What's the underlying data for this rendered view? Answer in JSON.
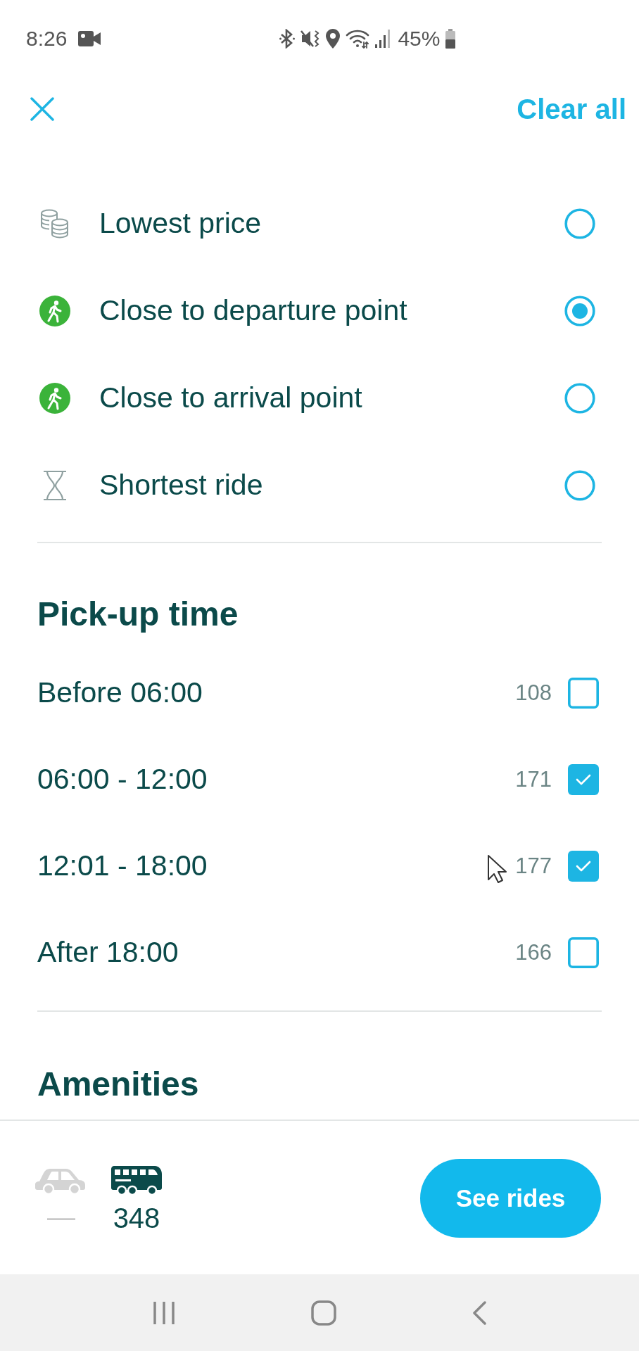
{
  "status_bar": {
    "time": "8:26",
    "battery": "45%"
  },
  "header": {
    "clear_label": "Clear all"
  },
  "sort_options": [
    {
      "kind": "coins",
      "label": "Lowest price",
      "selected": false
    },
    {
      "kind": "walk",
      "label": "Close to departure point",
      "selected": true
    },
    {
      "kind": "walk",
      "label": "Close to arrival point",
      "selected": false
    },
    {
      "kind": "hourglass",
      "label": "Shortest ride",
      "selected": false
    }
  ],
  "pickup_time": {
    "title": "Pick-up time",
    "options": [
      {
        "label": "Before 06:00",
        "count": "108",
        "checked": false
      },
      {
        "label": "06:00 - 12:00",
        "count": "171",
        "checked": true
      },
      {
        "label": "12:01 - 18:00",
        "count": "177",
        "checked": true
      },
      {
        "label": "After 18:00",
        "count": "166",
        "checked": false
      }
    ]
  },
  "amenities": {
    "title": "Amenities"
  },
  "footer": {
    "modes": [
      {
        "kind": "car",
        "count": "—",
        "active": false
      },
      {
        "kind": "bus",
        "count": "348",
        "active": true
      }
    ],
    "button": "See rides"
  }
}
